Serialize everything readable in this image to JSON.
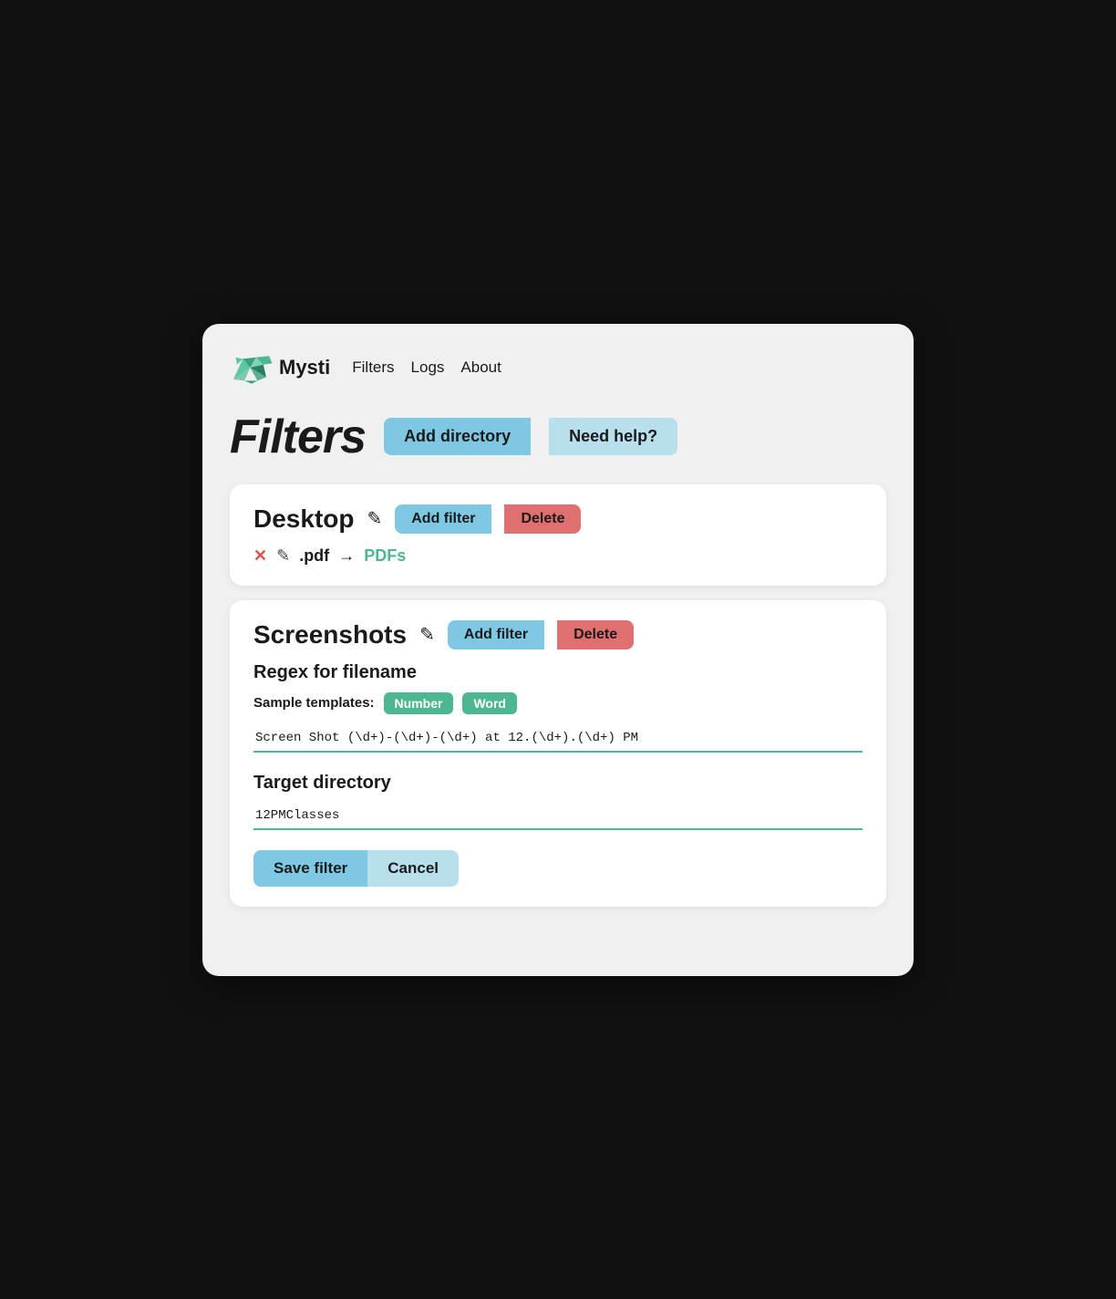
{
  "nav": {
    "logo_text": "Mysti",
    "links": [
      {
        "label": "Filters",
        "name": "nav-filters"
      },
      {
        "label": "Logs",
        "name": "nav-logs"
      },
      {
        "label": "About",
        "name": "nav-about"
      }
    ]
  },
  "page": {
    "title": "Filters",
    "btn_add_directory": "Add directory",
    "btn_need_help": "Need help?"
  },
  "desktop_card": {
    "title": "Desktop",
    "btn_add_filter": "Add filter",
    "btn_delete": "Delete",
    "filter": {
      "ext": ".pdf",
      "arrow": "→",
      "target": "PDFs"
    }
  },
  "screenshots_card": {
    "title": "Screenshots",
    "btn_add_filter": "Add filter",
    "btn_delete": "Delete",
    "regex_section": {
      "heading": "Regex for filename",
      "sample_label": "Sample templates:",
      "tag_number": "Number",
      "tag_word": "Word",
      "regex_value": "Screen Shot (\\d+)-(\\d+)-(\\d+) at 12.(\\d+).(\\d+) PM"
    },
    "target_section": {
      "heading": "Target directory",
      "value": "12PMClasses"
    },
    "btn_save": "Save filter",
    "btn_cancel": "Cancel"
  }
}
